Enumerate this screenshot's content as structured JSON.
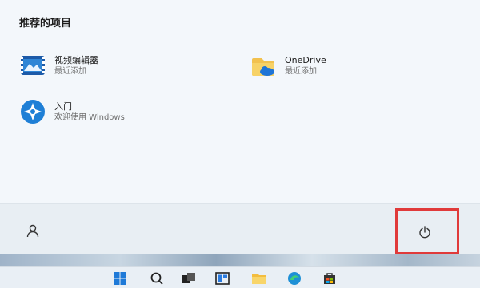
{
  "recommended": {
    "title": "推荐的项目",
    "items": [
      {
        "name": "视频编辑器",
        "subtitle": "最近添加",
        "icon": "video-editor-icon"
      },
      {
        "name": "OneDrive",
        "subtitle": "最近添加",
        "icon": "onedrive-icon"
      },
      {
        "name": "入门",
        "subtitle": "欢迎使用 Windows",
        "icon": "get-started-icon"
      }
    ]
  },
  "bottom": {
    "user_icon": "user-icon",
    "power_icon": "power-icon",
    "highlight_color": "#e03a3a"
  },
  "taskbar": {
    "icons": [
      "windows-start-icon",
      "search-icon",
      "task-view-icon",
      "widgets-icon",
      "file-explorer-icon",
      "edge-icon",
      "store-icon"
    ]
  }
}
